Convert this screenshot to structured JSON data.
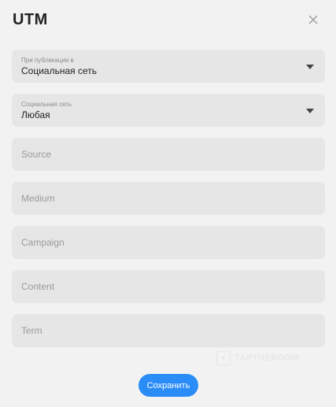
{
  "modal": {
    "title": "UTM",
    "close_icon": "close-icon"
  },
  "fields": {
    "publish_in": {
      "label": "При публикации в",
      "value": "Социальная сеть",
      "icon": "chevron-down-icon"
    },
    "social_network": {
      "label": "Социальная сеть",
      "value": "Любая",
      "icon": "chevron-down-icon"
    },
    "source": {
      "placeholder": "Source",
      "value": ""
    },
    "medium": {
      "placeholder": "Medium",
      "value": ""
    },
    "campaign": {
      "placeholder": "Campaign",
      "value": ""
    },
    "content": {
      "placeholder": "Content",
      "value": ""
    },
    "term": {
      "placeholder": "Term",
      "value": ""
    }
  },
  "watermark": {
    "icon": "watermark-logo",
    "text": "TAPTHEROOM"
  },
  "actions": {
    "save_label": "Сохранить"
  },
  "colors": {
    "background": "#f2f2f2",
    "field_background": "#e6e6e6",
    "primary": "#2a8cf7",
    "text": "#222222",
    "placeholder": "#9a9a9a"
  }
}
